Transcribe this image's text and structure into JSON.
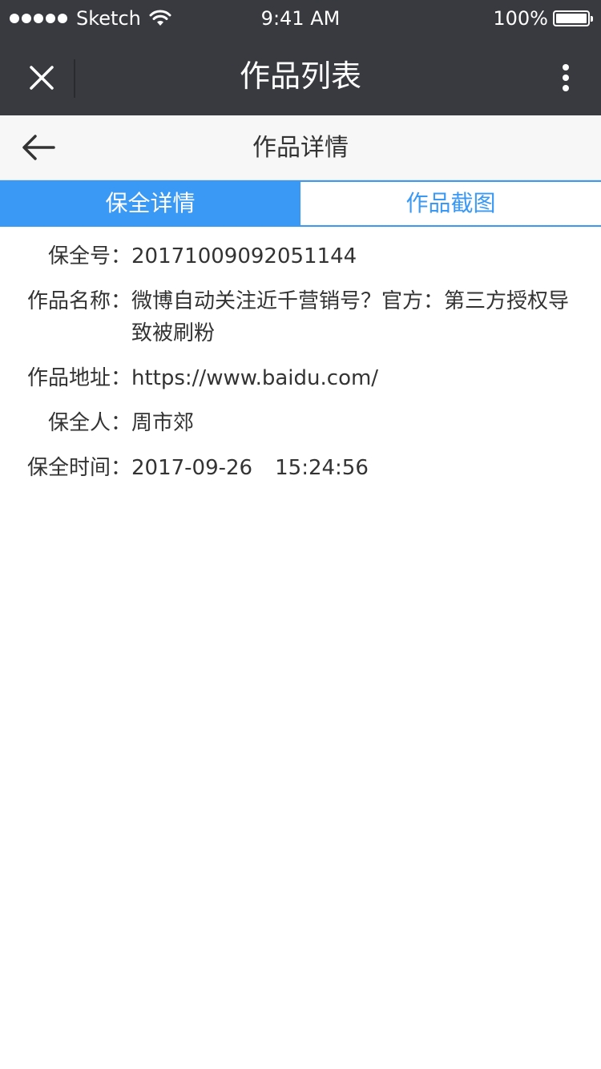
{
  "status_bar": {
    "carrier": "Sketch",
    "time": "9:41 AM",
    "battery": "100%"
  },
  "nav_bar": {
    "title": "作品列表",
    "close_icon": "close-icon",
    "more_icon": "more-vertical-icon"
  },
  "sub_header": {
    "title": "作品详情",
    "back_icon": "arrow-left-icon"
  },
  "tabs": [
    {
      "label": "保全详情",
      "active": true
    },
    {
      "label": "作品截图",
      "active": false
    }
  ],
  "details": {
    "preservation_no": {
      "label": "保全号：",
      "value": "20171009092051144"
    },
    "work_name": {
      "label": "作品名称：",
      "value": "微博自动关注近千营销号？官方：第三方授权导致被刷粉"
    },
    "work_url": {
      "label": "作品地址：",
      "value": "https://www.baidu.com/"
    },
    "preserver": {
      "label": "保全人：",
      "value": "周市郊"
    },
    "preservation_time": {
      "label": "保全时间：",
      "date": "2017-09-26",
      "time": "15:24:56"
    }
  },
  "colors": {
    "nav_background": "#393a3f",
    "accent_blue": "#3a99f5",
    "sub_header_background": "#f7f7f7",
    "text": "#333333"
  }
}
